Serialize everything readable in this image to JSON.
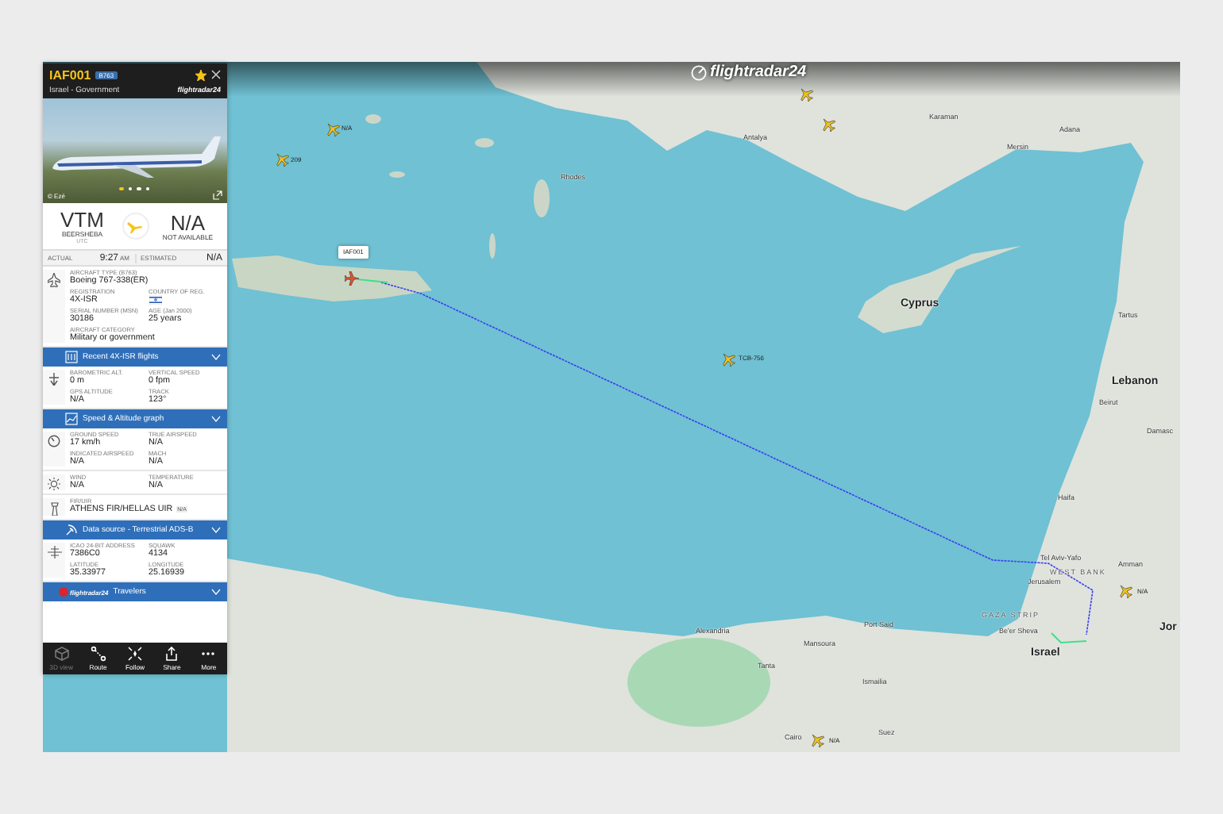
{
  "panel": {
    "callsign": "IAF001",
    "type_badge": "B763",
    "favorite": true,
    "operator": "Israel - Government",
    "logo": "flightradar24",
    "photo": {
      "credit": "© Ezé",
      "dots": [
        {
          "selected": true
        },
        {
          "selected": false
        },
        {
          "selected": false
        },
        {
          "selected": false
        }
      ]
    },
    "origin": {
      "code": "VTM",
      "name": "BEERSHEBA",
      "note": "UTC"
    },
    "destination": {
      "code": "N/A",
      "name": "NOT AVAILABLE"
    },
    "times": [
      {
        "label": "ACTUAL",
        "value": "9:27",
        "suffix": "AM"
      },
      {
        "label": "ESTIMATED",
        "value": "N/A"
      }
    ],
    "sections": [
      {
        "kind": "info",
        "rows": [
          [
            {
              "kind": "text",
              "label": "AIRCRAFT TYPE (B763)",
              "value": "Boeing 767-338(ER)"
            }
          ],
          [
            {
              "kind": "text",
              "label": "REGISTRATION",
              "value": "4X-ISR"
            },
            {
              "kind": "flag",
              "label": "COUNTRY OF REG."
            }
          ],
          [
            {
              "kind": "text",
              "label": "SERIAL NUMBER (MSN)",
              "value": "30186"
            },
            {
              "kind": "text",
              "label": "AGE (Jan 2000)",
              "value": "25 years"
            }
          ],
          [
            {
              "kind": "text",
              "label": "AIRCRAFT CATEGORY",
              "value": "Military or government"
            }
          ]
        ]
      },
      {
        "kind": "bar",
        "label": "Recent 4X-ISR flights"
      },
      {
        "kind": "info",
        "rows": [
          [
            {
              "kind": "text",
              "label": "BAROMETRIC ALT.",
              "value": "0 m"
            },
            {
              "kind": "text",
              "label": "VERTICAL SPEED",
              "value": "0 fpm"
            }
          ],
          [
            {
              "kind": "text",
              "label": "GPS ALTITUDE",
              "value": "N/A"
            },
            {
              "kind": "text",
              "label": "TRACK",
              "value": "123°"
            }
          ]
        ]
      },
      {
        "kind": "bar",
        "label": "Speed & Altitude graph"
      },
      {
        "kind": "info",
        "rows": [
          [
            {
              "kind": "text",
              "label": "GROUND SPEED",
              "value": "17 km/h"
            },
            {
              "kind": "text",
              "label": "TRUE AIRSPEED",
              "value": "N/A"
            }
          ],
          [
            {
              "kind": "text",
              "label": "INDICATED AIRSPEED",
              "value": "N/A"
            },
            {
              "kind": "text",
              "label": "MACH",
              "value": "N/A"
            }
          ]
        ]
      },
      {
        "kind": "info",
        "rows": [
          [
            {
              "kind": "text",
              "label": "WIND",
              "value": "N/A"
            },
            {
              "kind": "text",
              "label": "TEMPERATURE",
              "value": "N/A"
            }
          ]
        ]
      },
      {
        "kind": "info",
        "rows": [
          [
            {
              "kind": "text",
              "label": "FIR/UIR",
              "value": "ATHENS FIR/HELLAS UIR",
              "badge": "N/A"
            }
          ]
        ]
      },
      {
        "kind": "bar",
        "label": "Data source - Terrestrial ADS-B"
      },
      {
        "kind": "info",
        "rows": [
          [
            {
              "kind": "text",
              "label": "ICAO 24-BIT ADDRESS",
              "value": "7386C0"
            },
            {
              "kind": "text",
              "label": "SQUAWK",
              "value": "4134"
            }
          ],
          [
            {
              "kind": "text",
              "label": "LATITUDE",
              "value": "35.33977"
            },
            {
              "kind": "text",
              "label": "LONGITUDE",
              "value": "25.16939"
            }
          ]
        ]
      },
      {
        "kind": "brand_bar",
        "brand": "flightradar24",
        "label": "Travelers"
      }
    ],
    "toolbar": [
      {
        "label": "3D view",
        "disabled": true
      },
      {
        "label": "Route",
        "disabled": false
      },
      {
        "label": "Follow",
        "disabled": false
      },
      {
        "label": "Share",
        "disabled": false
      },
      {
        "label": "More",
        "disabled": false
      }
    ]
  },
  "map": {
    "logo": "flightradar24",
    "labels": [
      {
        "kind": "city",
        "text": "Karaman"
      },
      {
        "kind": "city",
        "text": "Antalya"
      },
      {
        "kind": "city",
        "text": "Adana"
      },
      {
        "kind": "city",
        "text": "Mersin"
      },
      {
        "kind": "city",
        "text": "Rhodes"
      },
      {
        "kind": "country",
        "text": "Cyprus"
      },
      {
        "kind": "city",
        "text": "Tartus"
      },
      {
        "kind": "country",
        "text": "Lebanon"
      },
      {
        "kind": "city",
        "text": "Beirut"
      },
      {
        "kind": "city",
        "text": "Damasc"
      },
      {
        "kind": "city",
        "text": "Haifa"
      },
      {
        "kind": "city",
        "text": "Tel Aviv-Yafo"
      },
      {
        "kind": "city",
        "text": "Amman"
      },
      {
        "kind": "region",
        "text": "WEST BANK"
      },
      {
        "kind": "city",
        "text": "Jerusalem"
      },
      {
        "kind": "region",
        "text": "GAZA STRIP"
      },
      {
        "kind": "city",
        "text": "Alexandria"
      },
      {
        "kind": "city",
        "text": "Port Said"
      },
      {
        "kind": "city",
        "text": "Be'er Sheva"
      },
      {
        "kind": "country",
        "text": "Jor"
      },
      {
        "kind": "city",
        "text": "Mansoura"
      },
      {
        "kind": "country",
        "text": "Israel"
      },
      {
        "kind": "city",
        "text": "Tanta"
      },
      {
        "kind": "city",
        "text": "Ismailia"
      },
      {
        "kind": "city",
        "text": "Cairo"
      },
      {
        "kind": "city",
        "text": "Suez"
      }
    ],
    "aircraft": [
      {
        "selected": false
      },
      {
        "selected": false
      },
      {
        "selected": false,
        "callsign": "N/A"
      },
      {
        "selected": false,
        "callsign": "209"
      },
      {
        "selected": true,
        "callsign": "IAF001"
      },
      {
        "selected": false,
        "callsign": "TCB-756"
      },
      {
        "selected": false,
        "callsign": "N/A"
      },
      {
        "selected": false,
        "callsign": "N/A"
      }
    ]
  }
}
